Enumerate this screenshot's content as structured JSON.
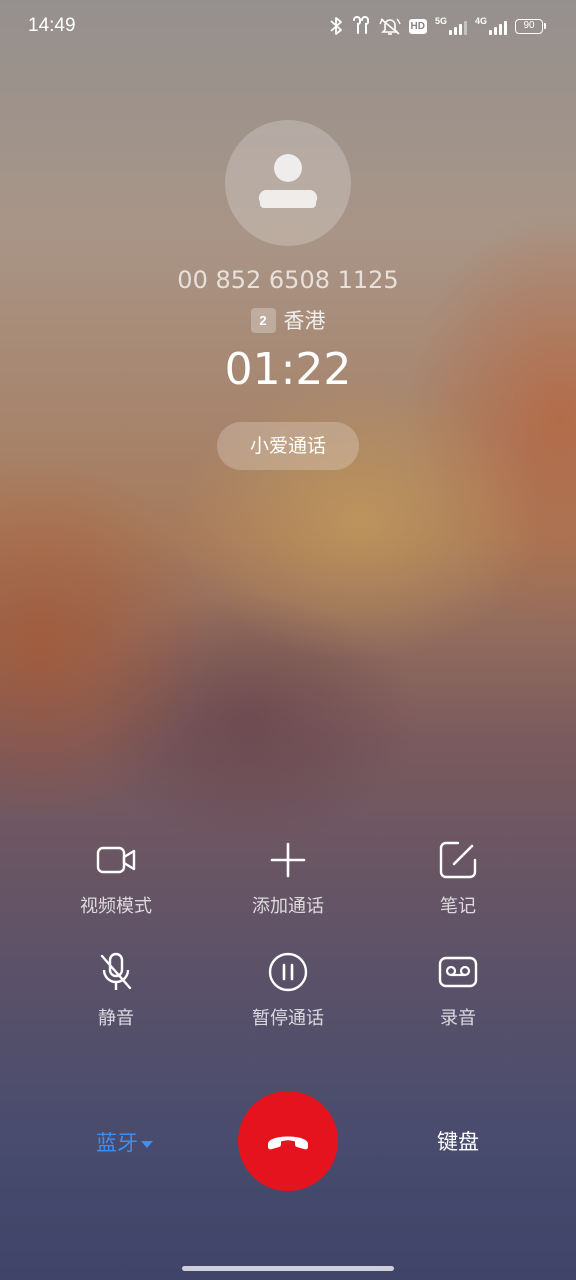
{
  "status_bar": {
    "time": "14:49",
    "icons": [
      "bluetooth-icon",
      "earbuds-icon",
      "vibrate-off-icon",
      "hd-voice-icon",
      "signal-5g-icon",
      "signal-4g-icon",
      "battery-icon"
    ],
    "hd_label": "HD",
    "sim1_network": "5G",
    "sim2_network": "4G",
    "battery_level": "90"
  },
  "caller": {
    "phone_number": "00 852 6508 1125",
    "sim_slot": "2",
    "location": "香港",
    "call_duration": "01:22",
    "assistant_pill": "小爱通话"
  },
  "controls": {
    "video_mode": "视频模式",
    "add_call": "添加通话",
    "notes": "笔记",
    "mute": "静音",
    "hold": "暂停通话",
    "record": "录音"
  },
  "bottom": {
    "audio_route": "蓝牙",
    "keypad": "键盘"
  },
  "colors": {
    "hangup": "#e5131d",
    "audio_route_active": "#3b8ff3"
  }
}
